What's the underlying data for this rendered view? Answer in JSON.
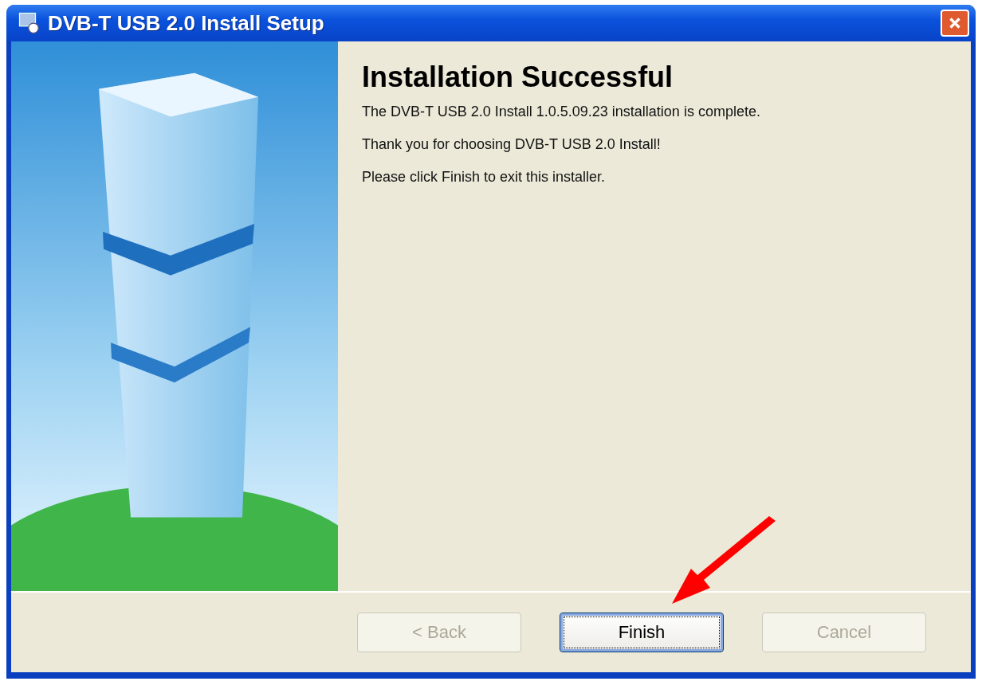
{
  "window": {
    "title": "DVB-T USB 2.0 Install Setup"
  },
  "heading": "Installation Successful",
  "paragraphs": [
    "The DVB-T USB 2.0 Install 1.0.5.09.23 installation is complete.",
    "Thank you for choosing DVB-T USB 2.0 Install!",
    "Please click Finish to exit this installer."
  ],
  "buttons": [
    {
      "label": "< Back",
      "disabled": true,
      "default": false
    },
    {
      "label": "Finish",
      "disabled": false,
      "default": true
    },
    {
      "label": "Cancel",
      "disabled": true,
      "default": false
    }
  ]
}
